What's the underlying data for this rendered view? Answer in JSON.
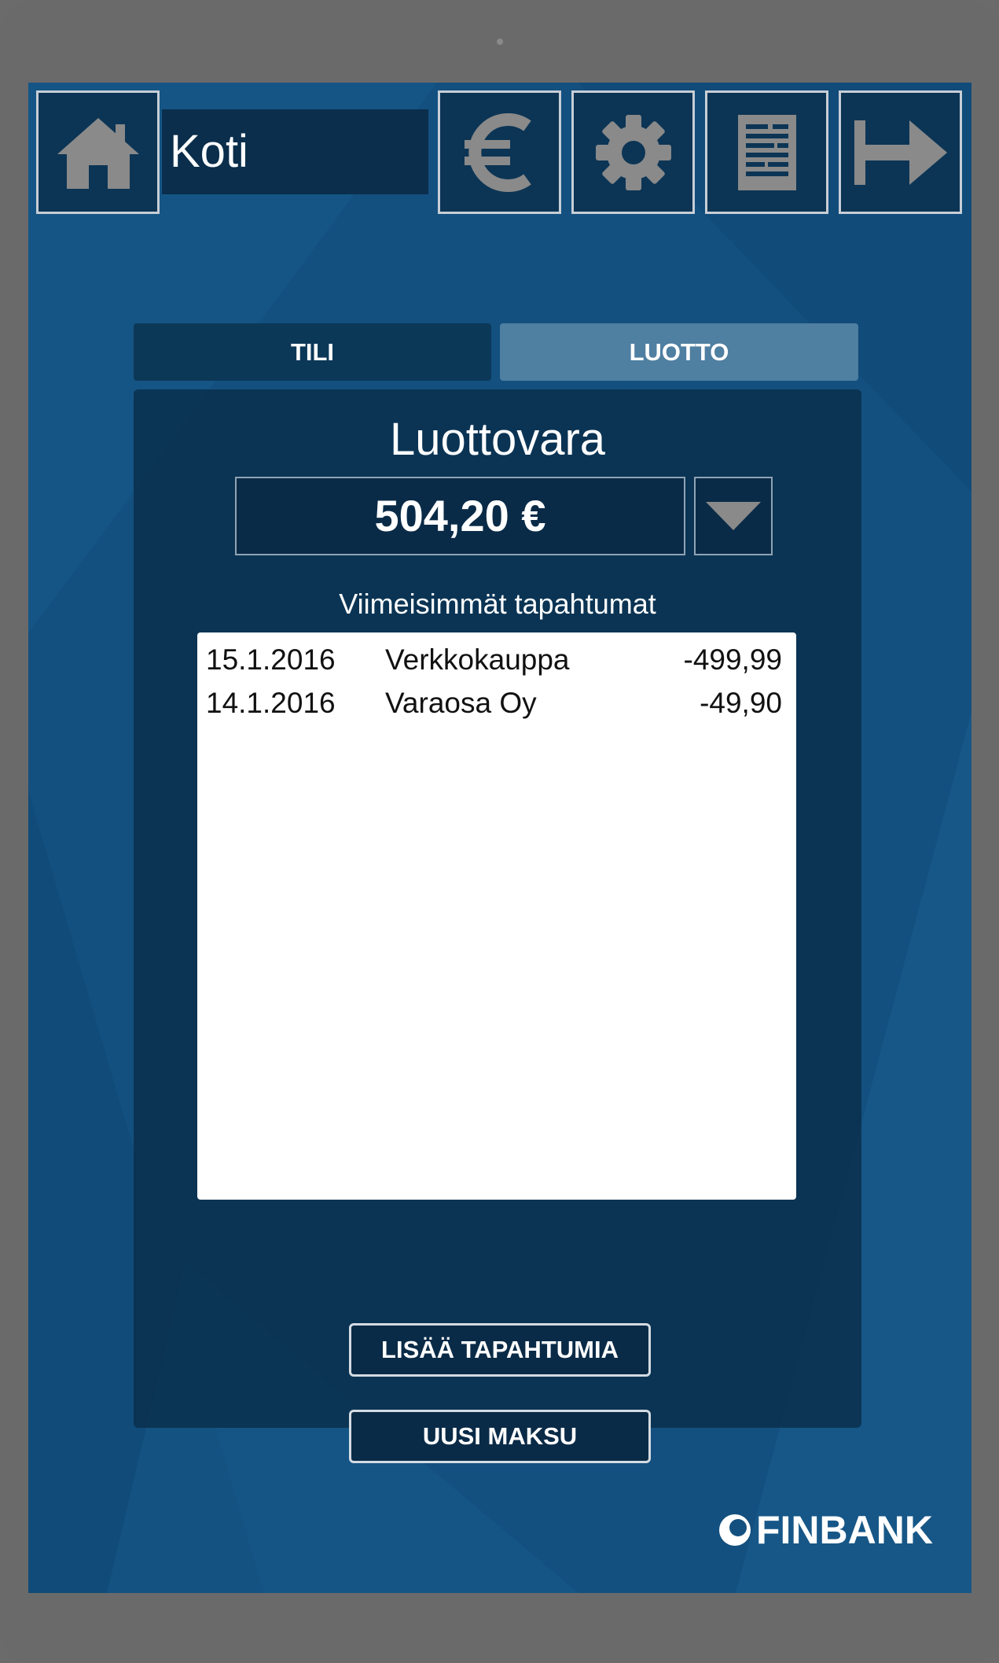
{
  "header": {
    "title": "Koti",
    "buttons": [
      {
        "name": "home-button",
        "icon": "home-icon"
      },
      {
        "name": "euro-button",
        "icon": "euro-icon"
      },
      {
        "name": "settings-button",
        "icon": "gear-icon"
      },
      {
        "name": "document-button",
        "icon": "document-icon"
      },
      {
        "name": "logout-button",
        "icon": "logout-arrow-icon"
      }
    ]
  },
  "tabs": [
    {
      "label": "TILI",
      "active": false
    },
    {
      "label": "LUOTTO",
      "active": true
    }
  ],
  "credit": {
    "heading": "Luottovara",
    "balance": "504,20 €"
  },
  "transactions": {
    "heading": "Viimeisimmät tapahtumat",
    "rows": [
      {
        "date": "15.1.2016",
        "name": "Verkkokauppa",
        "amount": "-499,99"
      },
      {
        "date": "14.1.2016",
        "name": "Varaosa Oy",
        "amount": "-49,90"
      }
    ]
  },
  "actions": {
    "more_label": "LISÄÄ TAPAHTUMIA",
    "new_payment_label": "UUSI MAKSU"
  },
  "brand": {
    "name": "FINBANK"
  },
  "colors": {
    "screen_bg": "#13507f",
    "panel_bg": "#0a2e4b",
    "active_tab": "#4f7fa1",
    "inactive_tab": "#0c3858",
    "icon_gray": "#8a8a8a"
  }
}
